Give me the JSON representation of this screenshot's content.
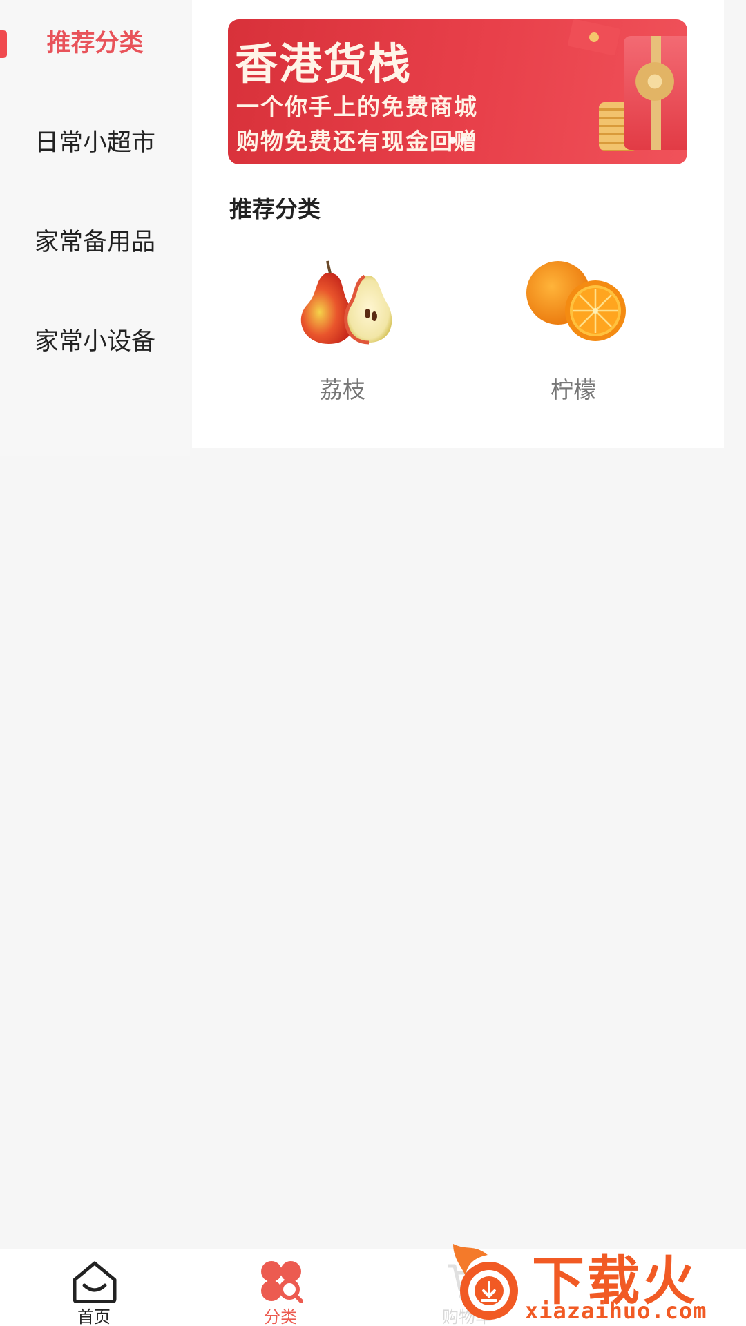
{
  "sidebar": {
    "items": [
      {
        "label": "推荐分类",
        "active": true
      },
      {
        "label": "日常小超市",
        "active": false
      },
      {
        "label": "家常备用品",
        "active": false
      },
      {
        "label": "家常小设备",
        "active": false
      }
    ]
  },
  "banner": {
    "title": "香港货栈",
    "line1": "一个你手上的免费商城",
    "line2": "购物免费还有现金回赠"
  },
  "main": {
    "section_title": "推荐分类",
    "items": [
      {
        "label": "荔枝",
        "icon": "pear-icon"
      },
      {
        "label": "柠檬",
        "icon": "orange-icon"
      }
    ]
  },
  "tabbar": {
    "tabs": [
      {
        "label": "首页",
        "icon": "home-icon"
      },
      {
        "label": "分类",
        "icon": "category-icon",
        "active": true
      },
      {
        "label": "购物车",
        "icon": "cart-icon"
      }
    ]
  },
  "watermark": {
    "text": "下载火",
    "domain": "xiazaihuo.com"
  },
  "colors": {
    "accent": "#e8535a",
    "tab_active": "#ec5b50",
    "banner_red": "#e23b45",
    "watermark": "#f15a24"
  }
}
